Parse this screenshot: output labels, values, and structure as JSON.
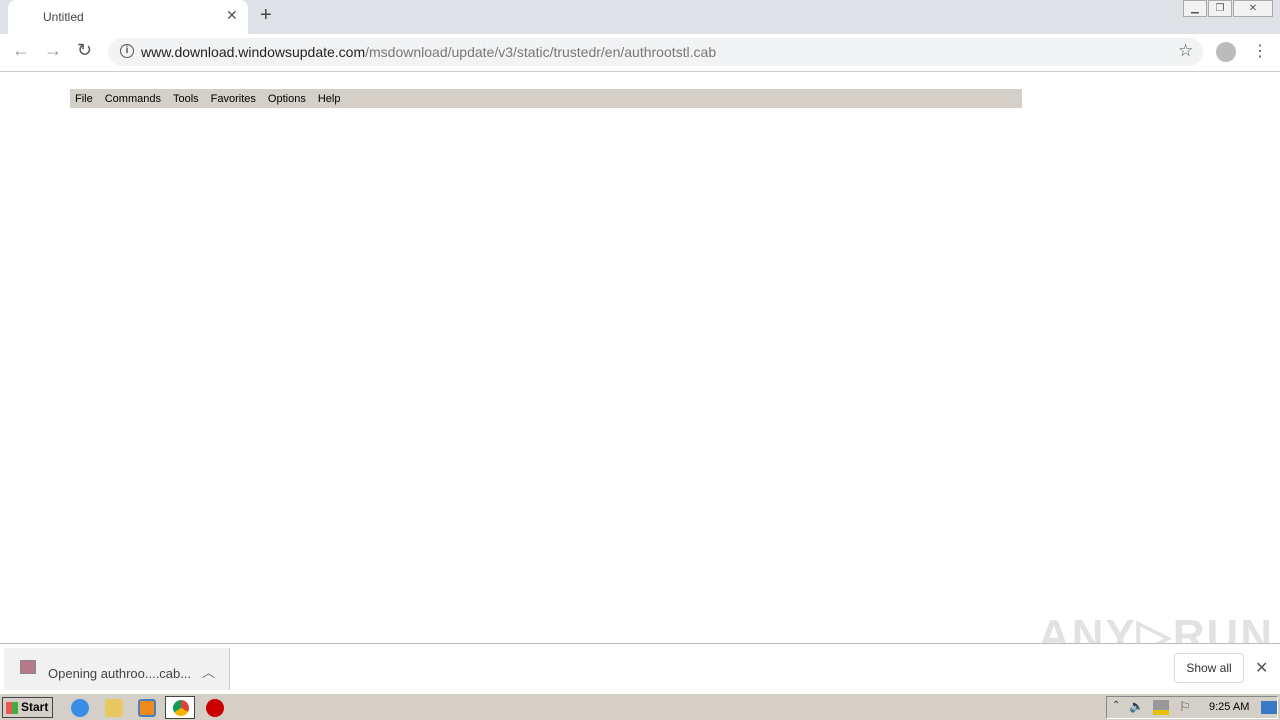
{
  "browser": {
    "tab_title": "Untitled",
    "url_host": "www.download.windowsupdate.com",
    "url_path": "/msdownload/update/v3/static/trustedr/en/authrootstl.cab"
  },
  "app_menu": [
    "File",
    "Commands",
    "Tools",
    "Favorites",
    "Options",
    "Help"
  ],
  "download_bar": {
    "item_text": "Opening authroo....cab...",
    "show_all": "Show all"
  },
  "watermark": "ANY RUN",
  "taskbar": {
    "start_label": "Start",
    "clock": "9:25 AM"
  }
}
